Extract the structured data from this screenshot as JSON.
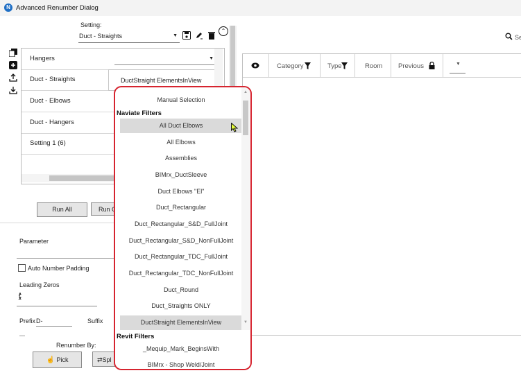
{
  "window": {
    "title": "Advanced Renumber Dialog",
    "logo_letter": "N"
  },
  "setting": {
    "label": "Setting:",
    "value": "Duct - Straights"
  },
  "setting_list": {
    "items": [
      "Hangers",
      "Duct - Straights",
      "Duct - Elbows",
      "Duct - Hangers",
      "Setting 1 (6)"
    ],
    "doc_combo_value": "DuctStraight ElementsInView"
  },
  "buttons": {
    "run_all": "Run All",
    "run_other": "Run C",
    "pick": "Pick",
    "split": "Spl"
  },
  "left_panel": {
    "parameter_label": "Parameter",
    "auto_number_padding": "Auto Number Padding",
    "leading_zeros_label": "Leading Zeros",
    "leading_zeros_value": "1",
    "prefix_label": "Prefix",
    "prefix_value": "D-",
    "suffix_label": "Suffix",
    "renumber_by_label": "Renumber By:"
  },
  "search": {
    "placeholder": "Se"
  },
  "grid": {
    "columns": [
      "Category",
      "Type",
      "Room",
      "Previous"
    ]
  },
  "dropdown": {
    "items_top": [
      "Manual Selection"
    ],
    "group_naviate": "Naviate Filters",
    "naviate_items": [
      "All Duct Elbows",
      "All Elbows",
      "Assemblies",
      "BIMrx_DuctSleeve",
      "Duct Elbows \"El\"",
      "Duct_Rectangular",
      "Duct_Rectangular_S&D_FullJoint",
      "Duct_Rectangular_S&D_NonFullJoint",
      "Duct_Rectangular_TDC_FullJoint",
      "Duct_Rectangular_TDC_NonFullJoint",
      "Duct_Round",
      "Duct_Straights ONLY",
      "DuctStraight ElementsInView"
    ],
    "group_revit": "Revit Filters",
    "revit_items": [
      "_Mequip_Mark_BeginsWith",
      "BIMrx - Shop Weld/Joint"
    ],
    "hovered_item": "All Duct Elbows",
    "selected_item": "DuctStraight ElementsInView"
  },
  "colors": {
    "highlight_border": "#d6242f",
    "accent": "#1f6fc5"
  }
}
